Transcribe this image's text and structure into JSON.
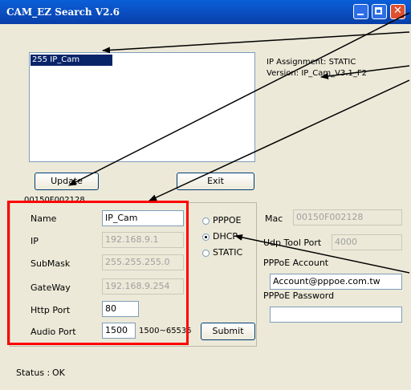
{
  "window": {
    "title": "CAM_EZ Search V2.6"
  },
  "device_list": {
    "items": [
      "255 IP_Cam"
    ]
  },
  "info": {
    "assignment": "IP Assignment:  STATIC",
    "version": "Version: IP_Cam_V3.1_F2"
  },
  "buttons": {
    "update": "Update",
    "exit": "Exit",
    "submit": "Submit"
  },
  "group_caption": "00150F002128",
  "form": {
    "name_label": "Name",
    "name_value": "IP_Cam",
    "ip_label": "IP",
    "ip_value": "192.168.9.1",
    "submask_label": "SubMask",
    "submask_value": "255.255.255.0",
    "gateway_label": "GateWay",
    "gateway_value": "192.168.9.254",
    "http_label": "Http Port",
    "http_value": "80",
    "audio_label": "Audio Port",
    "audio_value": "1500",
    "audio_range": "1500~65535"
  },
  "mode": {
    "pppoe": "PPPOE",
    "dhcp": "DHCP",
    "static": "STATIC",
    "selected": "DHCP"
  },
  "right": {
    "mac_label": "Mac",
    "mac_value": "00150F002128",
    "udp_label": "Udp Tool Port",
    "udp_value": "4000",
    "pppoe_account_label": "PPPoE Account",
    "pppoe_account_value": "Account@pppoe.com.tw",
    "pppoe_password_label": "PPPoE Password",
    "pppoe_password_value": ""
  },
  "status": {
    "label": "Status :",
    "value": "OK"
  },
  "colors": {
    "titlebar": "#0a4fc2",
    "highlight": "#ff0000",
    "face": "#ece9d8"
  }
}
